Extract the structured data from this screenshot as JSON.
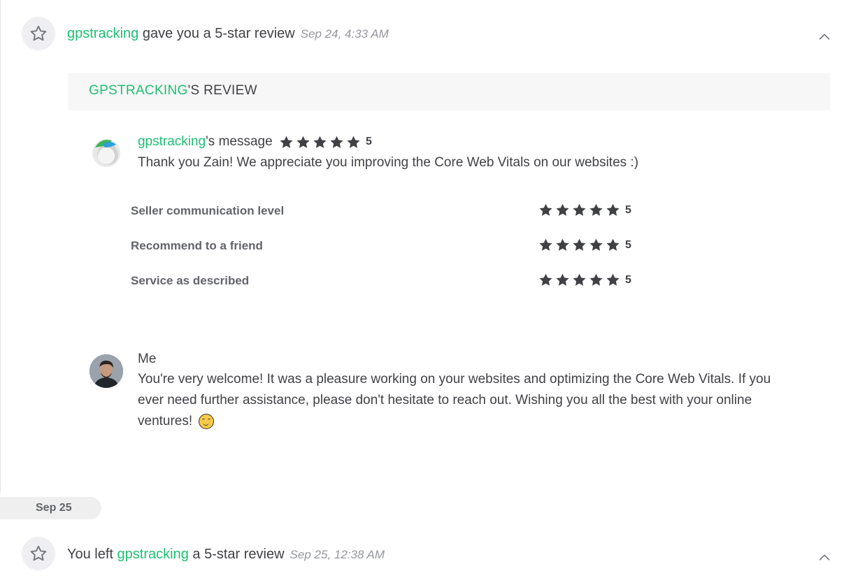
{
  "event1": {
    "user": "gpstracking",
    "text": " gave you a 5-star review",
    "timestamp": "Sep 24, 4:33 AM",
    "icon": "star-outline-icon"
  },
  "review": {
    "header_user": "GPSTRACKING",
    "header_suffix": "'S REVIEW",
    "buyer_message": {
      "user": "gpstracking",
      "suffix": "'s message",
      "rating": "5",
      "body": "Thank you Zain! We appreciate you improving the Core Web Vitals on our websites :)"
    },
    "ratings": [
      {
        "label": "Seller communication level",
        "value": "5"
      },
      {
        "label": "Recommend to a friend",
        "value": "5"
      },
      {
        "label": "Service as described",
        "value": "5"
      }
    ],
    "reply": {
      "author": "Me",
      "body": "You're very welcome! It was a pleasure working on your websites and optimizing the Core Web Vitals. If you ever need further assistance, please don't hesitate to reach out. Wishing you all the best with your online ventures!"
    }
  },
  "date_divider": "Sep 25",
  "event2": {
    "prefix": "You left ",
    "user": "gpstracking",
    "suffix": " a 5-star review",
    "timestamp": "Sep 25, 12:38 AM",
    "icon": "star-outline-icon"
  },
  "colors": {
    "accent": "#1dbf73",
    "text": "#404145",
    "muted": "#95979d",
    "star": "#404145"
  }
}
